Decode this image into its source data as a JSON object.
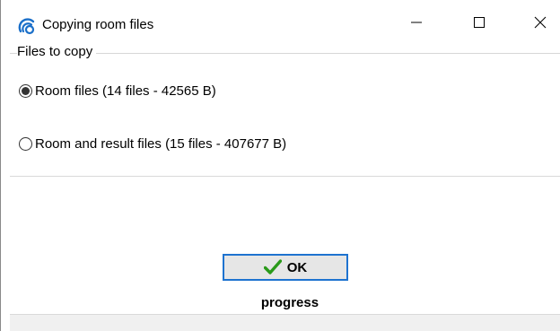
{
  "window": {
    "title": "Copying room files",
    "icon": "app-logo-icon",
    "controls": {
      "minimize": "minimize-icon",
      "maximize": "maximize-icon",
      "close": "close-icon"
    }
  },
  "group": {
    "label": "Files to copy",
    "options": [
      {
        "label": "Room files  (14 files - 42565  B)",
        "selected": true
      },
      {
        "label": "Room and result files  (15 files - 407677  B)",
        "selected": false
      }
    ]
  },
  "actions": {
    "ok_label": "OK",
    "ok_icon": "checkmark-icon",
    "ok_icon_color": "#2a9a1a"
  },
  "status": {
    "progress_label": "progress"
  },
  "colors": {
    "accent": "#1e73d0",
    "button_face": "#e6e6e6",
    "status_strip": "#f0f0f0"
  }
}
